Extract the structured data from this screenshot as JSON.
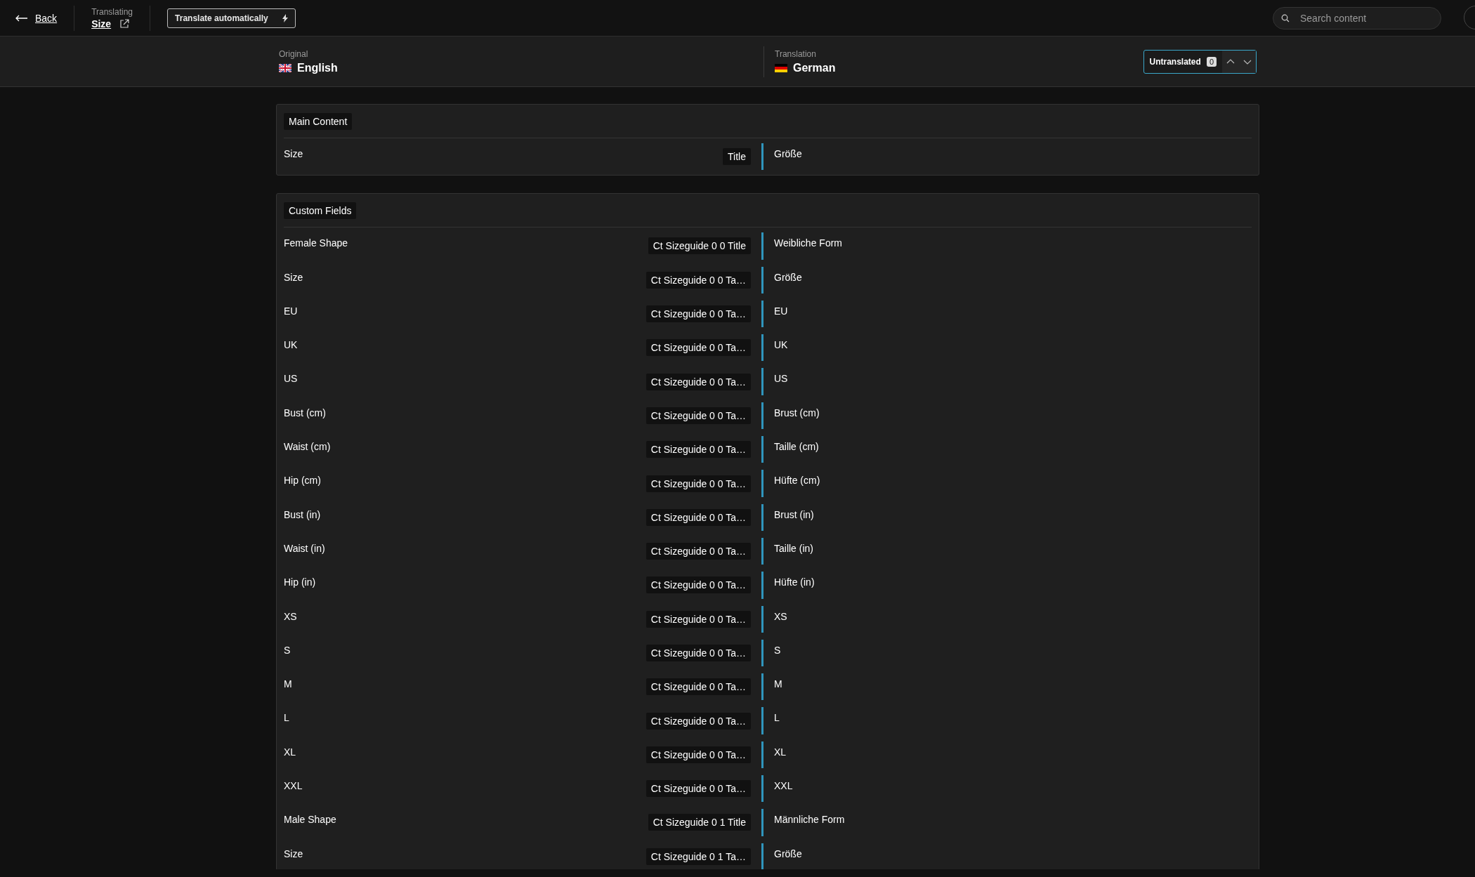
{
  "top_bar": {
    "back": "Back",
    "context_label": "Translating",
    "item_title": "Size",
    "auto_button": "Translate automatically",
    "search": {
      "placeholder": "Search content"
    }
  },
  "languages": {
    "original": {
      "label": "Original",
      "name": "English"
    },
    "translation": {
      "label": "Translation",
      "name": "German"
    },
    "filter": {
      "label": "Untranslated",
      "count": "0"
    }
  },
  "sections": [
    {
      "title": "Main Content",
      "rows": [
        {
          "original": "Size",
          "tag": "Title",
          "translation": "Größe"
        }
      ]
    },
    {
      "title": "Custom Fields",
      "rows": [
        {
          "original": "Female Shape",
          "tag": "Ct Sizeguide 0 0 Title",
          "translation": "Weibliche Form"
        },
        {
          "original": "Size",
          "tag": "Ct Sizeguide 0 0 Ta…",
          "translation": "Größe"
        },
        {
          "original": "EU",
          "tag": "Ct Sizeguide 0 0 Ta…",
          "translation": "EU"
        },
        {
          "original": "UK",
          "tag": "Ct Sizeguide 0 0 Ta…",
          "translation": "UK"
        },
        {
          "original": "US",
          "tag": "Ct Sizeguide 0 0 Ta…",
          "translation": "US"
        },
        {
          "original": "Bust (cm)",
          "tag": "Ct Sizeguide 0 0 Ta…",
          "translation": "Brust (cm)"
        },
        {
          "original": "Waist (cm)",
          "tag": "Ct Sizeguide 0 0 Ta…",
          "translation": "Taille (cm)"
        },
        {
          "original": "Hip (cm)",
          "tag": "Ct Sizeguide 0 0 Ta…",
          "translation": "Hüfte (cm)"
        },
        {
          "original": "Bust (in)",
          "tag": "Ct Sizeguide 0 0 Ta…",
          "translation": "Brust (in)"
        },
        {
          "original": "Waist (in)",
          "tag": "Ct Sizeguide 0 0 Ta…",
          "translation": "Taille (in)"
        },
        {
          "original": "Hip (in)",
          "tag": "Ct Sizeguide 0 0 Ta…",
          "translation": "Hüfte (in)"
        },
        {
          "original": "XS",
          "tag": "Ct Sizeguide 0 0 Ta…",
          "translation": "XS"
        },
        {
          "original": "S",
          "tag": "Ct Sizeguide 0 0 Ta…",
          "translation": "S"
        },
        {
          "original": "M",
          "tag": "Ct Sizeguide 0 0 Ta…",
          "translation": "M"
        },
        {
          "original": "L",
          "tag": "Ct Sizeguide 0 0 Ta…",
          "translation": "L"
        },
        {
          "original": "XL",
          "tag": "Ct Sizeguide 0 0 Ta…",
          "translation": "XL"
        },
        {
          "original": "XXL",
          "tag": "Ct Sizeguide 0 0 Ta…",
          "translation": "XXL"
        },
        {
          "original": "Male Shape",
          "tag": "Ct Sizeguide 0 1 Title",
          "translation": "Männliche Form"
        },
        {
          "original": "Size",
          "tag": "Ct Sizeguide 0 1 Ta…",
          "translation": "Größe"
        }
      ]
    }
  ]
}
